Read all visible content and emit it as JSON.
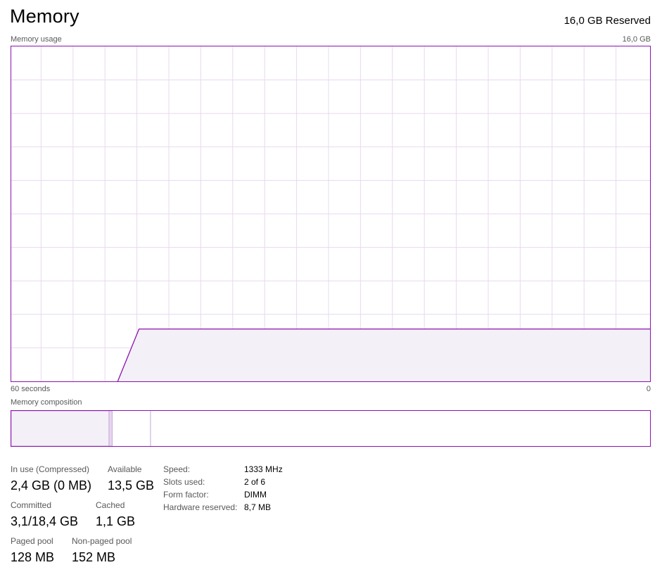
{
  "header": {
    "title": "Memory",
    "reserved": "16,0 GB Reserved"
  },
  "usage_graph": {
    "label": "Memory usage",
    "max_label": "16,0 GB",
    "time_left": "60 seconds",
    "time_right": "0",
    "line_color": "#8b12ae",
    "fill_color": "#f4f0f7",
    "grid_color": "#e8d8ef",
    "chart_data": {
      "type": "area",
      "x": [
        60,
        50,
        48,
        40,
        0
      ],
      "values": [
        0,
        0,
        2.5,
        2.5,
        2.5
      ],
      "ylim": [
        0,
        16
      ],
      "xlim": [
        60,
        0
      ],
      "grid": true
    }
  },
  "composition": {
    "label": "Memory composition",
    "in_use_fraction": 0.153,
    "modified_fraction": 0.005,
    "standby_fraction": 0.06
  },
  "stats": {
    "in_use_label": "In use (Compressed)",
    "in_use_value": "2,4 GB (0 MB)",
    "available_label": "Available",
    "available_value": "13,5 GB",
    "committed_label": "Committed",
    "committed_value": "3,1/18,4 GB",
    "cached_label": "Cached",
    "cached_value": "1,1 GB",
    "paged_label": "Paged pool",
    "paged_value": "128 MB",
    "nonpaged_label": "Non-paged pool",
    "nonpaged_value": "152 MB"
  },
  "specs": {
    "speed_label": "Speed:",
    "speed_value": "1333 MHz",
    "slots_label": "Slots used:",
    "slots_value": "2 of 6",
    "form_label": "Form factor:",
    "form_value": "DIMM",
    "hw_label": "Hardware reserved:",
    "hw_value": "8,7 MB"
  }
}
